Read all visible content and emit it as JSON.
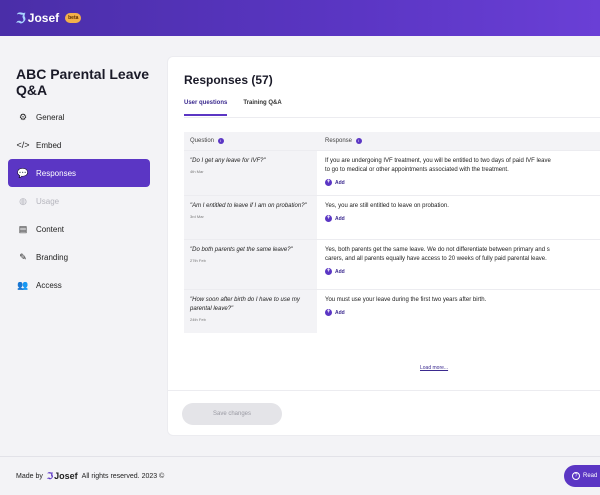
{
  "topbar": {
    "brand": "Josef",
    "beta": "beta"
  },
  "page": {
    "title": "ABC Parental Leave Q&A"
  },
  "nav": [
    {
      "label": "General",
      "icon": "gear-icon"
    },
    {
      "label": "Embed",
      "icon": "code-icon"
    },
    {
      "label": "Responses",
      "icon": "chat-icon",
      "active": true
    },
    {
      "label": "Usage",
      "icon": "globe-icon",
      "disabled": true
    },
    {
      "label": "Content",
      "icon": "document-icon"
    },
    {
      "label": "Branding",
      "icon": "pen-icon"
    },
    {
      "label": "Access",
      "icon": "users-icon"
    }
  ],
  "responses": {
    "title": "Responses (57)",
    "tabs": [
      "User questions",
      "Training Q&A"
    ],
    "col_question": "Question",
    "col_response": "Response",
    "add_label": "Add",
    "rows": [
      {
        "question": "\"Do I get any leave for IVF?\"",
        "date": "4th Mar",
        "response1": "If you are undergoing IVF treatment, you will be entitled to two days of paid IVF leave",
        "response2": "to go to medical or other appointments associated with the treatment."
      },
      {
        "question": "\"Am I entitled to leave if I am on probation?\"",
        "date": "3rd Mar",
        "response1": "Yes, you are still entitled to leave on probation.",
        "response2": ""
      },
      {
        "question": "\"Do both parents get the same leave?\"",
        "date": "27th Feb",
        "response1": "Yes, both parents get the same leave. We do not differentiate between primary and s",
        "response2": "carers, and all parents equally have access to 20 weeks of fully paid parental leave."
      },
      {
        "question": "\"How soon after birth do I have to use my parental leave?\"",
        "date": "24th Feb",
        "response1": "You must use your leave during the first two years after birth.",
        "response2": ""
      }
    ],
    "load_more": "Load more...",
    "save": "Save changes"
  },
  "footer": {
    "made_by": "Made by",
    "brand": "Josef",
    "rights": "All rights reserved. 2023 ©",
    "help": "Read"
  },
  "colors": {
    "accent": "#5b36c4",
    "topbar": "#4a2ea8"
  }
}
